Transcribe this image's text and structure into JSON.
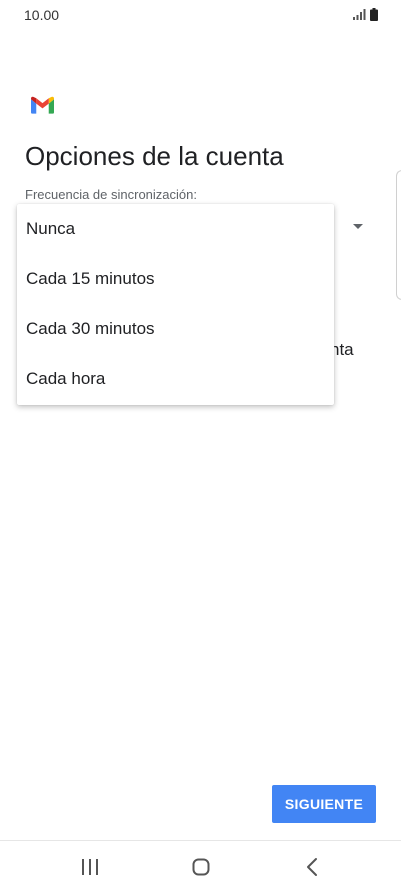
{
  "status_bar": {
    "time": "10.00",
    "icons": [
      "signal-icon",
      "battery-icon"
    ]
  },
  "app": {
    "logo_icon": "gmail-logo-icon",
    "colors": {
      "gmail_red": "#ea4335",
      "gmail_blue": "#4285f4",
      "gmail_green": "#34a853",
      "gmail_yellow": "#fbbc05",
      "gmail_dark_red": "#c5221f"
    }
  },
  "page": {
    "title": "Opciones de la cuenta",
    "sync_label": "Frecuencia de sincronización:",
    "behind_text_fragment": "nta"
  },
  "dropdown": {
    "options": [
      {
        "label": "Nunca"
      },
      {
        "label": "Cada 15 minutos"
      },
      {
        "label": "Cada 30 minutos"
      },
      {
        "label": "Cada hora"
      }
    ]
  },
  "actions": {
    "next_label": "SIGUIENTE",
    "next_color": "#4285f4"
  },
  "nav_bar": {
    "icons": [
      "recents-icon",
      "home-icon",
      "back-icon"
    ]
  }
}
